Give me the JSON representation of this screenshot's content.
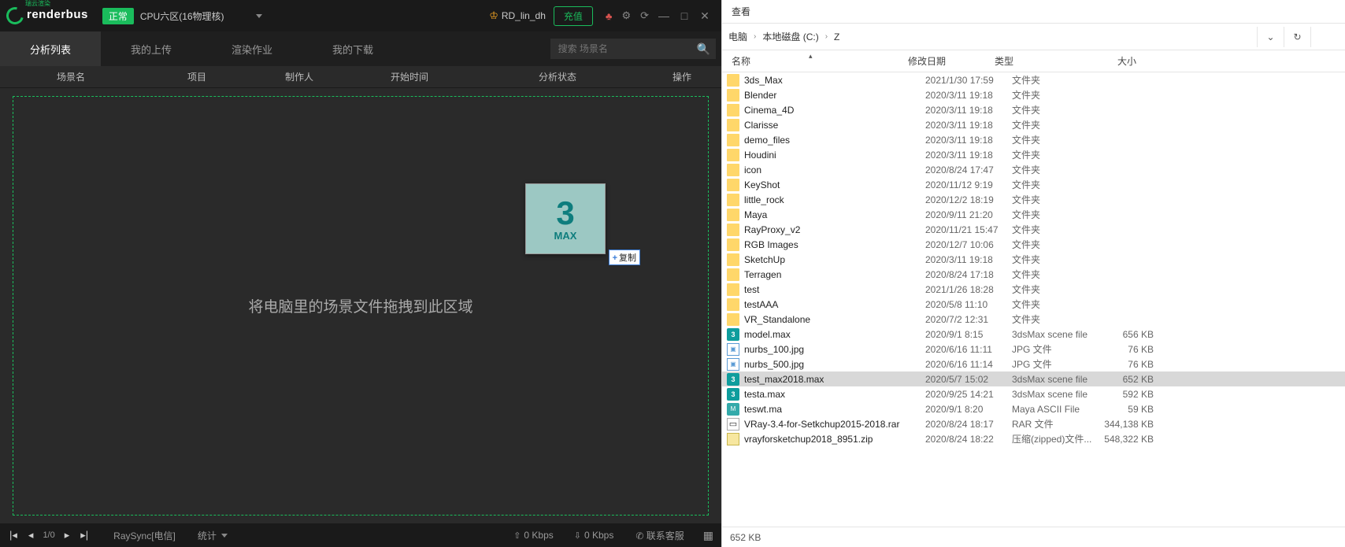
{
  "app": {
    "logo_text": "renderbus",
    "logo_sub": "瑞云渲染",
    "status": "正常",
    "region": "CPU六区(16物理核)",
    "user": "RD_lin_dh",
    "recharge": "充值",
    "tabs": [
      "分析列表",
      "我的上传",
      "渲染作业",
      "我的下载"
    ],
    "search_placeholder": "搜索 场景名",
    "columns": [
      "场景名",
      "项目",
      "制作人",
      "开始时间",
      "分析状态",
      "操作"
    ],
    "drop_text": "将电脑里的场景文件拖拽到此区域",
    "drag_label": "MAX",
    "copy_badge": "复制",
    "pager": "1/0",
    "raysync": "RaySync[电信]",
    "stats_label": "统计",
    "up_speed": "0 Kbps",
    "down_speed": "0 Kbps",
    "support": "联系客服"
  },
  "explorer": {
    "view_menu": "查看",
    "crumbs": [
      "电脑",
      "本地磁盘 (C:)",
      "Z"
    ],
    "headers": {
      "name": "名称",
      "date": "修改日期",
      "type": "类型",
      "size": "大小"
    },
    "status": "652 KB",
    "rows": [
      {
        "icon": "folder",
        "name": "3ds_Max",
        "date": "2021/1/30 17:59",
        "type": "文件夹",
        "size": ""
      },
      {
        "icon": "folder",
        "name": "Blender",
        "date": "2020/3/11 19:18",
        "type": "文件夹",
        "size": ""
      },
      {
        "icon": "folder",
        "name": "Cinema_4D",
        "date": "2020/3/11 19:18",
        "type": "文件夹",
        "size": ""
      },
      {
        "icon": "folder",
        "name": "Clarisse",
        "date": "2020/3/11 19:18",
        "type": "文件夹",
        "size": ""
      },
      {
        "icon": "folder",
        "name": "demo_files",
        "date": "2020/3/11 19:18",
        "type": "文件夹",
        "size": ""
      },
      {
        "icon": "folder",
        "name": "Houdini",
        "date": "2020/3/11 19:18",
        "type": "文件夹",
        "size": ""
      },
      {
        "icon": "folder",
        "name": "icon",
        "date": "2020/8/24 17:47",
        "type": "文件夹",
        "size": ""
      },
      {
        "icon": "folder",
        "name": "KeyShot",
        "date": "2020/11/12 9:19",
        "type": "文件夹",
        "size": ""
      },
      {
        "icon": "folder",
        "name": "little_rock",
        "date": "2020/12/2 18:19",
        "type": "文件夹",
        "size": ""
      },
      {
        "icon": "folder",
        "name": "Maya",
        "date": "2020/9/11 21:20",
        "type": "文件夹",
        "size": ""
      },
      {
        "icon": "folder",
        "name": "RayProxy_v2",
        "date": "2020/11/21 15:47",
        "type": "文件夹",
        "size": ""
      },
      {
        "icon": "folder",
        "name": "RGB Images",
        "date": "2020/12/7 10:06",
        "type": "文件夹",
        "size": ""
      },
      {
        "icon": "folder",
        "name": "SketchUp",
        "date": "2020/3/11 19:18",
        "type": "文件夹",
        "size": ""
      },
      {
        "icon": "folder",
        "name": "Terragen",
        "date": "2020/8/24 17:18",
        "type": "文件夹",
        "size": ""
      },
      {
        "icon": "folder",
        "name": "test",
        "date": "2021/1/26 18:28",
        "type": "文件夹",
        "size": ""
      },
      {
        "icon": "folder",
        "name": "testAAA",
        "date": "2020/5/8 11:10",
        "type": "文件夹",
        "size": ""
      },
      {
        "icon": "folder",
        "name": "VR_Standalone",
        "date": "2020/7/2 12:31",
        "type": "文件夹",
        "size": ""
      },
      {
        "icon": "max",
        "name": "model.max",
        "date": "2020/9/1 8:15",
        "type": "3dsMax scene file",
        "size": "656 KB"
      },
      {
        "icon": "jpg",
        "name": "nurbs_100.jpg",
        "date": "2020/6/16 11:11",
        "type": "JPG 文件",
        "size": "76 KB"
      },
      {
        "icon": "jpg",
        "name": "nurbs_500.jpg",
        "date": "2020/6/16 11:14",
        "type": "JPG 文件",
        "size": "76 KB"
      },
      {
        "icon": "max",
        "name": "test_max2018.max",
        "date": "2020/5/7 15:02",
        "type": "3dsMax scene file",
        "size": "652 KB",
        "sel": true
      },
      {
        "icon": "max",
        "name": "testa.max",
        "date": "2020/9/25 14:21",
        "type": "3dsMax scene file",
        "size": "592 KB"
      },
      {
        "icon": "ma",
        "name": "teswt.ma",
        "date": "2020/9/1 8:20",
        "type": "Maya ASCII File",
        "size": "59 KB"
      },
      {
        "icon": "rar",
        "name": "VRay-3.4-for-Setkchup2015-2018.rar",
        "date": "2020/8/24 18:17",
        "type": "RAR 文件",
        "size": "344,138 KB"
      },
      {
        "icon": "zip",
        "name": "vrayforsketchup2018_8951.zip",
        "date": "2020/8/24 18:22",
        "type": "压缩(zipped)文件...",
        "size": "548,322 KB"
      }
    ]
  }
}
